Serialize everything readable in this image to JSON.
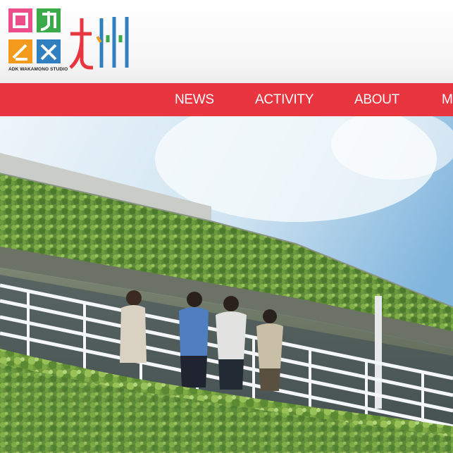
{
  "brand": {
    "logo_alt": "ワカモノ研究所 logo",
    "logo_caption": "ADK WAKAMONO STUDIO",
    "colors": {
      "pink": "#ec4e8a",
      "green": "#3aaa4a",
      "orange": "#f39a1c",
      "blue": "#2f7fc1",
      "red": "#e8353f"
    }
  },
  "nav": {
    "items": [
      {
        "label": "NEWS"
      },
      {
        "label": "ACTIVITY"
      },
      {
        "label": "ABOUT"
      },
      {
        "label": "M"
      }
    ],
    "color": "#e8353f"
  },
  "hero": {
    "image_alt": "Four young people on a balcony of an ivy-covered building"
  }
}
